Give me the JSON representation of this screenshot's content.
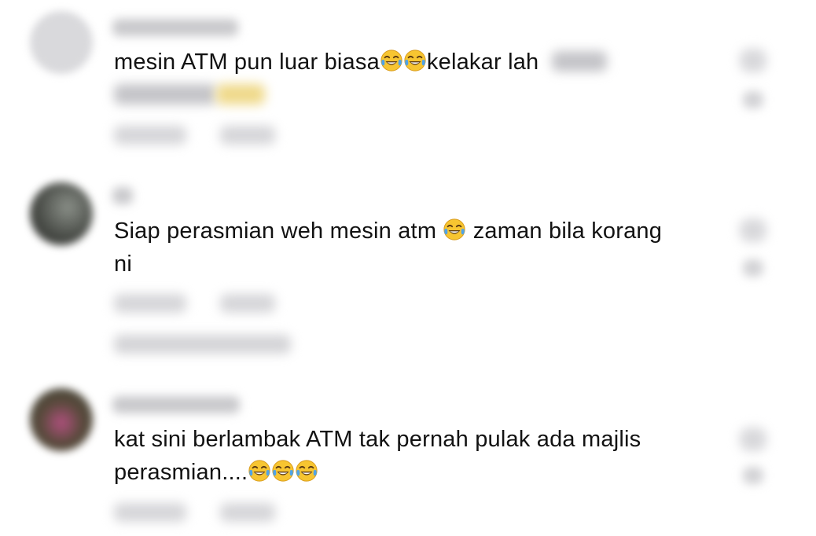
{
  "comments": [
    {
      "text_before": "mesin ATM pun luar biasa",
      "emojis_mid": [
        "face-with-tears-of-joy",
        "face-with-tears-of-joy"
      ],
      "text_after": "kelakar lah",
      "redacted_text": true
    },
    {
      "text_before": "Siap perasmian weh mesin atm ",
      "emojis_mid": [
        "face-with-tears-of-joy"
      ],
      "text_after": " zaman bila korang ni",
      "redacted_text": false
    },
    {
      "text_before": "kat sini berlambak ATM tak pernah pulak ada majlis perasmian....",
      "emojis_mid": [
        "face-with-tears-of-joy",
        "face-with-tears-of-joy",
        "face-with-tears-of-joy"
      ],
      "text_after": "",
      "redacted_text": false
    }
  ],
  "icons": {
    "emoji": "face-with-tears-of-joy-icon",
    "like": "heart-icon"
  },
  "colors": {
    "text": "#121212",
    "redaction": "#c4c4c8",
    "emoji_face": "#f7c531",
    "emoji_tear": "#4fa3e8"
  }
}
